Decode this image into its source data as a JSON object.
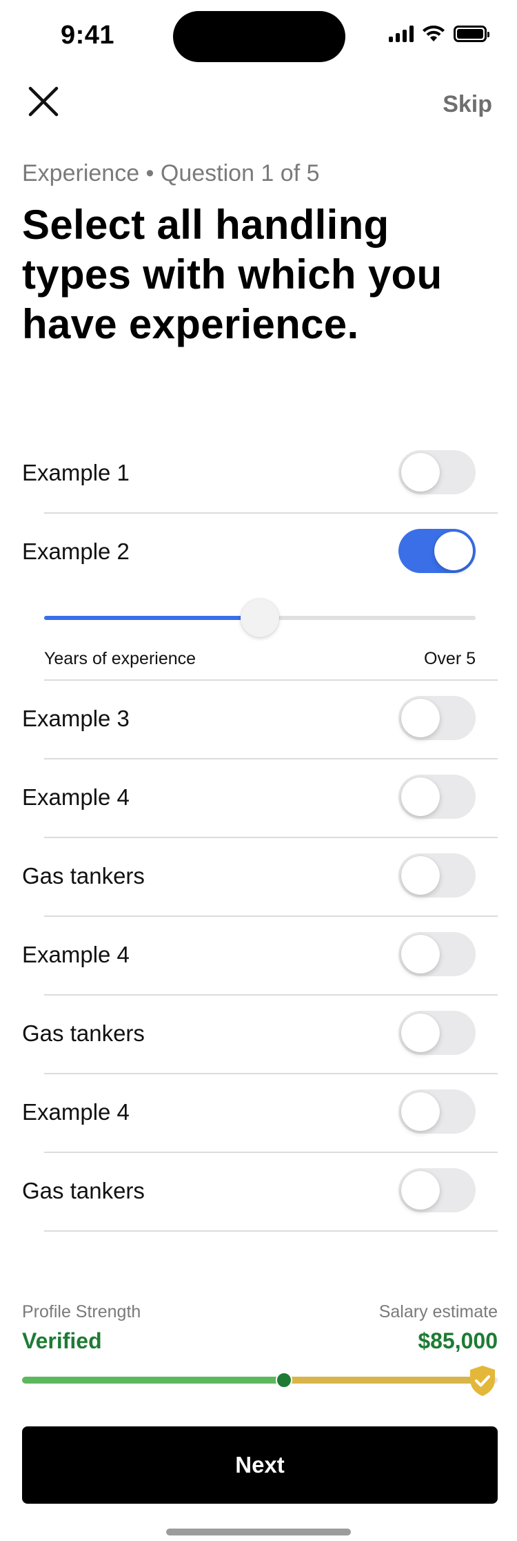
{
  "status_bar": {
    "time": "9:41"
  },
  "header": {
    "close_icon": "close-icon",
    "skip_label": "Skip"
  },
  "question": {
    "meta": "Experience • Question 1 of 5",
    "title": "Select all handling types with which you have experience."
  },
  "options": [
    {
      "label": "Example 1",
      "enabled": false
    },
    {
      "label": "Example 2",
      "enabled": true
    },
    {
      "label": "Example 3",
      "enabled": false
    },
    {
      "label": "Example 4",
      "enabled": false
    },
    {
      "label": "Gas tankers",
      "enabled": false
    },
    {
      "label": "Example 4",
      "enabled": false
    },
    {
      "label": "Gas tankers",
      "enabled": false
    },
    {
      "label": "Example 4",
      "enabled": false
    },
    {
      "label": "Gas tankers",
      "enabled": false
    }
  ],
  "experience_slider": {
    "label": "Years of experience",
    "value_label": "Over 5",
    "fraction": 0.5
  },
  "footer": {
    "profile_strength_label": "Profile Strength",
    "profile_strength_value": "Verified",
    "salary_label": "Salary estimate",
    "salary_value": "$85,000",
    "progress_verified_fraction": 0.55,
    "progress_salary_fraction": 0.96,
    "next_label": "Next"
  },
  "colors": {
    "accent_blue": "#3a6fe8",
    "verified_green": "#1e7b34",
    "progress_green": "#5cb85c",
    "progress_gold": "#d8b54a",
    "shield_gold": "#e3b83a"
  }
}
